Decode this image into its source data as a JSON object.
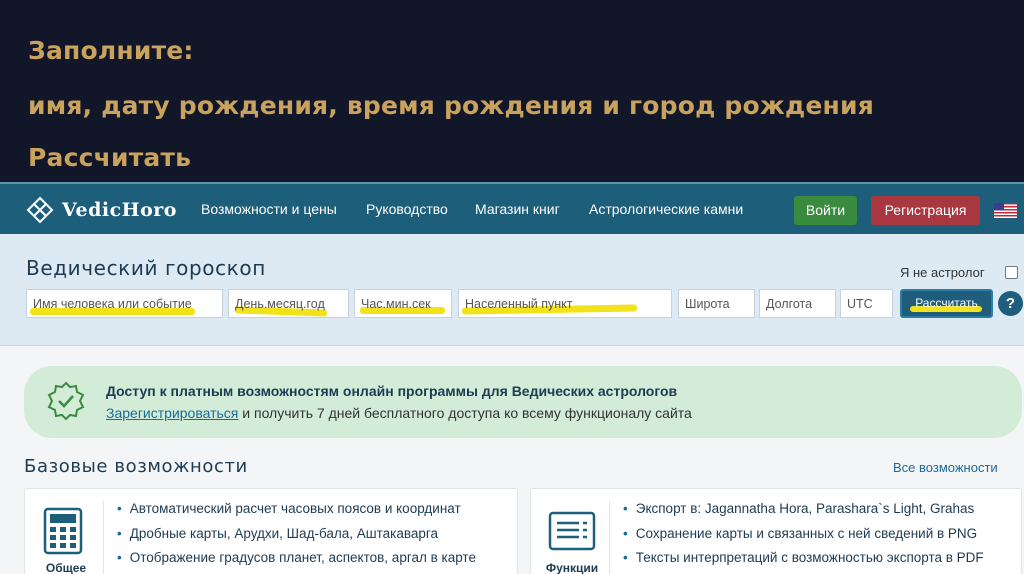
{
  "slide": {
    "line1": "Заполните:",
    "line2": "имя, дату рождения, время рождения и город рождения",
    "line3": "Рассчитать"
  },
  "navbar": {
    "logo_text": "VedicHoro",
    "links": [
      "Возможности и цены",
      "Руководство",
      "Магазин книг",
      "Астрологические камни"
    ],
    "login_label": "Войти",
    "register_label": "Регистрация"
  },
  "form": {
    "title": "Ведический гороскоп",
    "not_astrologer_label": "Я не астролог",
    "fields": {
      "name_placeholder": "Имя человека или событие",
      "date_placeholder": "День.месяц.год",
      "time_placeholder": "Час.мин.сек",
      "place_placeholder": "Населенный пункт",
      "lat_placeholder": "Широта",
      "lon_placeholder": "Долгота",
      "utc_placeholder": "UTC"
    },
    "calc_label": "Рассчитать",
    "help_label": "?"
  },
  "promo": {
    "title": "Доступ к платным возможностям онлайн программы для Ведических астрологов",
    "link": "Зарегистрироваться",
    "rest": " и получить 7 дней бесплатного доступа ко всему функционалу сайта"
  },
  "features": {
    "title": "Базовые возможности",
    "all_link": "Все возможности",
    "cards": [
      {
        "caption": "Общее",
        "icon": "calculator-icon",
        "items": [
          "Автоматический расчет часовых поясов и координат",
          "Дробные карты, Арудхи, Шад-бала, Аштакаварга",
          "Отображение градусов планет, аспектов, аргал в карте"
        ]
      },
      {
        "caption": "Функции",
        "icon": "document-list-icon",
        "items": [
          "Экспорт в: Jagannatha Hora, Parashara`s Light, Grahas",
          "Сохранение карты и связанных с ней сведений в PNG",
          "Тексты интерпретаций с возможностью экспорта в PDF"
        ]
      }
    ]
  },
  "colors": {
    "slide_bg": "#121629",
    "slide_text": "#c9a25e",
    "navbar_bg": "#1d5e7b",
    "login_bg": "#3a8a3f",
    "register_bg": "#a8373f",
    "form_bg": "#dde9f3",
    "promo_bg": "#d3ecd8",
    "highlight": "#f2e21a"
  }
}
